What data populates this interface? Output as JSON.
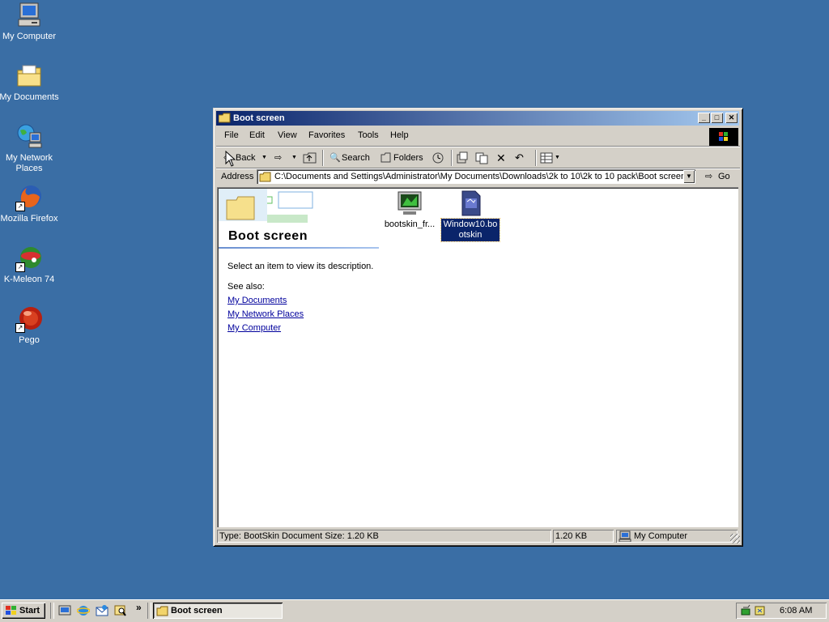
{
  "desktop": {
    "icons": [
      {
        "label": "My Computer",
        "icon": "computer-icon"
      },
      {
        "label": "My Documents",
        "icon": "documents-folder-icon"
      },
      {
        "label": "My Network Places",
        "icon": "network-icon"
      },
      {
        "label": "Mozilla Firefox",
        "icon": "firefox-icon"
      },
      {
        "label": "K-Meleon 74",
        "icon": "k-meleon-icon"
      },
      {
        "label": "Pego",
        "icon": "pego-icon"
      }
    ]
  },
  "window": {
    "title": "Boot screen",
    "menu": [
      "File",
      "Edit",
      "View",
      "Favorites",
      "Tools",
      "Help"
    ],
    "toolbar": {
      "back": "Back",
      "search": "Search",
      "folders": "Folders"
    },
    "address": {
      "label": "Address",
      "value": "C:\\Documents and Settings\\Administrator\\My Documents\\Downloads\\2k to 10\\2k to 10 pack\\Boot screen",
      "go": "Go"
    },
    "webview": {
      "heading": "Boot screen",
      "description": "Select an item to view its description.",
      "see_also": "See also:",
      "links": [
        "My Documents",
        "My Network Places",
        "My Computer"
      ]
    },
    "files": [
      {
        "name": "bootskin_fr...",
        "icon": "bootskin-app-icon",
        "selected": false
      },
      {
        "name": "Window10.bootskin",
        "icon": "bootskin-document-icon",
        "selected": true
      }
    ],
    "status": {
      "type_size": "Type: BootSkin Document Size: 1.20 KB",
      "size": "1.20 KB",
      "zone": "My Computer"
    }
  },
  "taskbar": {
    "start": "Start",
    "task": "Boot screen",
    "time": "6:08 AM",
    "chevron": "»"
  },
  "colors": {
    "desktop": "#3a6ea5",
    "title_active_start": "#0a246a",
    "title_active_end": "#a6caf0",
    "selection": "#0a246a",
    "link": "#00009c"
  }
}
